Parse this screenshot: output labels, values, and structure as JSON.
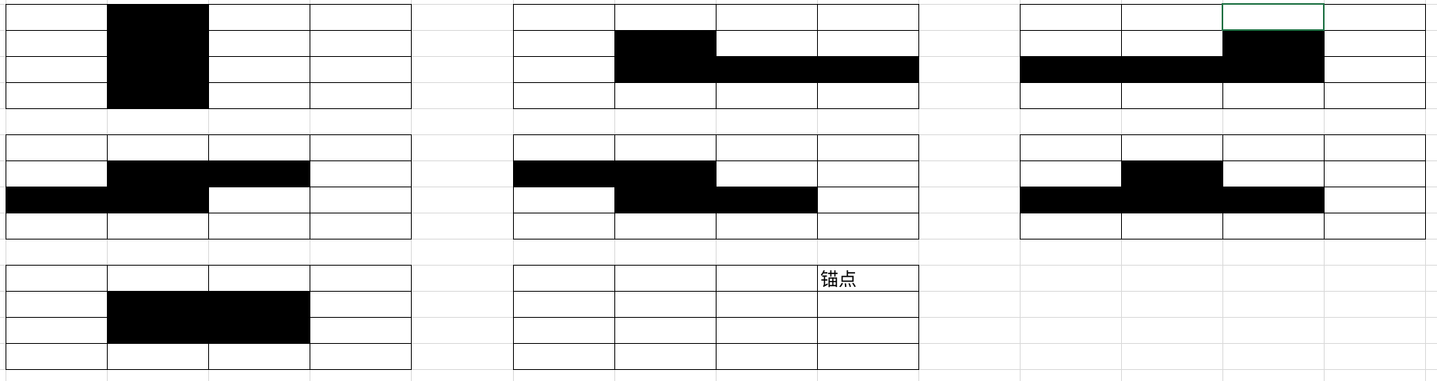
{
  "spreadsheet": {
    "colors": {
      "gridline": "#d9d9d9",
      "border": "#000000",
      "fill": "#000000",
      "selection": "#217346",
      "background": "#ffffff"
    },
    "anchor_label": "锚点",
    "selected_cell": {
      "block": 2,
      "row": 0,
      "col": 2
    },
    "blocks": [
      {
        "id": "block-1",
        "filled": [
          [
            0,
            1
          ],
          [
            1,
            1
          ],
          [
            2,
            1
          ],
          [
            3,
            1
          ]
        ]
      },
      {
        "id": "block-2",
        "filled": [
          [
            1,
            1
          ],
          [
            2,
            1
          ],
          [
            2,
            2
          ],
          [
            2,
            3
          ]
        ]
      },
      {
        "id": "block-3",
        "filled": [
          [
            1,
            2
          ],
          [
            2,
            0
          ],
          [
            2,
            1
          ],
          [
            2,
            2
          ]
        ]
      },
      {
        "id": "block-4",
        "filled": [
          [
            1,
            1
          ],
          [
            1,
            2
          ],
          [
            2,
            0
          ],
          [
            2,
            1
          ]
        ]
      },
      {
        "id": "block-5",
        "filled": [
          [
            1,
            0
          ],
          [
            1,
            1
          ],
          [
            2,
            1
          ],
          [
            2,
            2
          ]
        ]
      },
      {
        "id": "block-6",
        "filled": [
          [
            1,
            1
          ],
          [
            2,
            0
          ],
          [
            2,
            1
          ],
          [
            2,
            2
          ]
        ]
      },
      {
        "id": "block-7",
        "filled": [
          [
            1,
            1
          ],
          [
            1,
            2
          ],
          [
            2,
            1
          ],
          [
            2,
            2
          ]
        ]
      },
      {
        "id": "block-8",
        "filled": [],
        "anchor": [
          0,
          3
        ]
      }
    ]
  }
}
